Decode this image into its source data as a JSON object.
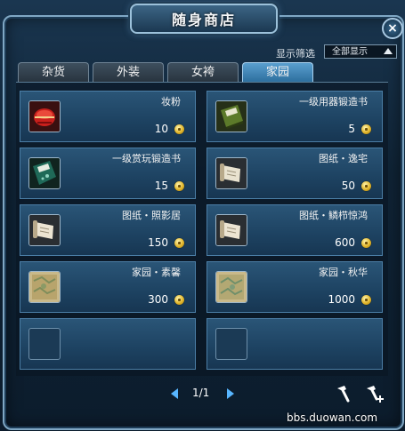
{
  "window": {
    "title": "随身商店",
    "close_label": "×"
  },
  "filter": {
    "label": "显示筛选",
    "value": "全部显示"
  },
  "tabs": [
    {
      "label": "杂货",
      "active": false
    },
    {
      "label": "外装",
      "active": false
    },
    {
      "label": "女袴",
      "active": false
    },
    {
      "label": "家园",
      "active": true
    }
  ],
  "items": [
    {
      "name": "妆粉",
      "price": "10",
      "icon": "red-pouch-icon"
    },
    {
      "name": "一级用器锻造书",
      "price": "5",
      "icon": "green-book-icon"
    },
    {
      "name": "一级赏玩锻造书",
      "price": "15",
      "icon": "teal-book-icon"
    },
    {
      "name": "图纸・逸宅",
      "price": "50",
      "icon": "scroll-icon"
    },
    {
      "name": "图纸・照影居",
      "price": "150",
      "icon": "scroll-icon"
    },
    {
      "name": "图纸・鳞栉惊鸿",
      "price": "600",
      "icon": "scroll-icon"
    },
    {
      "name": "家园・素馨",
      "price": "300",
      "icon": "map-tile-icon"
    },
    {
      "name": "家园・秋华",
      "price": "1000",
      "icon": "map-tile-icon"
    },
    {
      "name": "",
      "price": "",
      "icon": "empty-slot"
    },
    {
      "name": "",
      "price": "",
      "icon": "empty-slot"
    }
  ],
  "pager": {
    "text": "1/1"
  },
  "tools": {
    "buy": "hammer-icon",
    "repair": "hammer-plus-icon"
  },
  "watermark": "bbs.duowan.com",
  "colors": {
    "accent": "#58b6ff",
    "coin": "#e1b52a",
    "active_tab": "#4a8fc0"
  }
}
